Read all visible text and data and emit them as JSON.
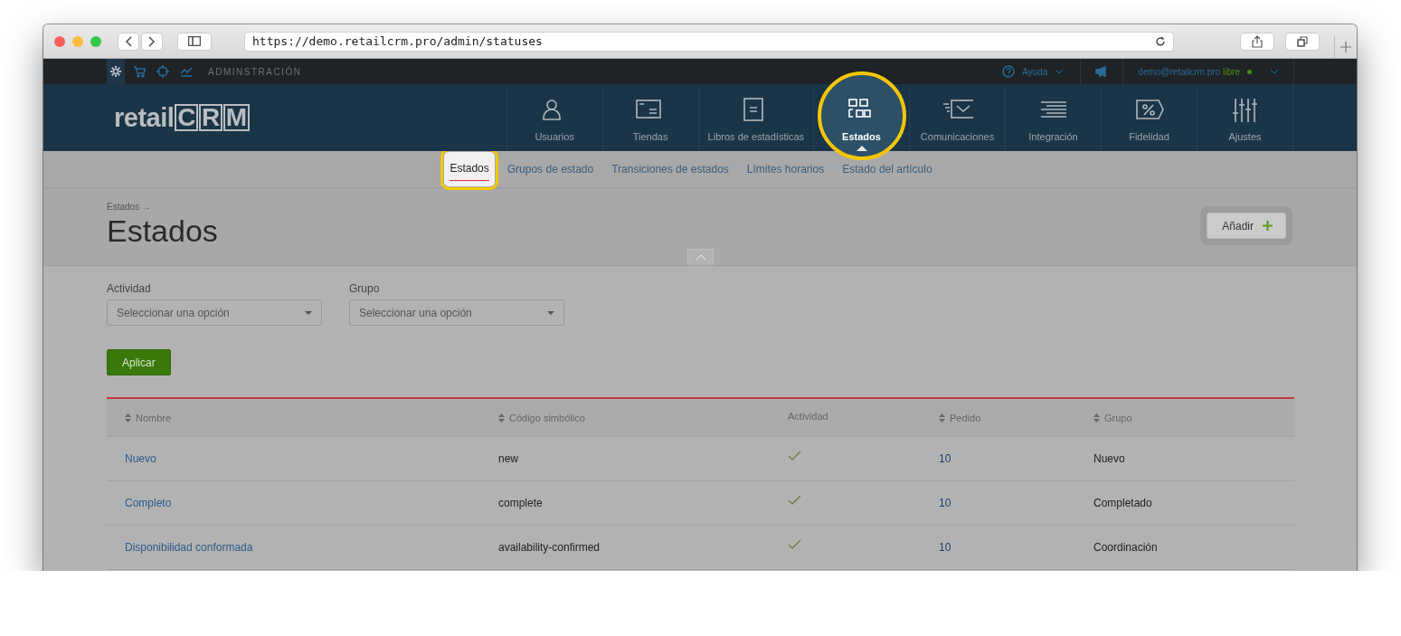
{
  "browser": {
    "url": "https://demo.retailcrm.pro/admin/statuses"
  },
  "top_bar": {
    "icons": [
      {
        "kind": "gear",
        "selected": true
      },
      {
        "kind": "cart",
        "selected": false
      },
      {
        "kind": "target",
        "selected": false
      },
      {
        "kind": "chart",
        "selected": false
      }
    ],
    "section_label": "ADMINSTRACIÓN",
    "help": "Ayuda",
    "user": "demo@retailcrm.pro",
    "plan": "libre"
  },
  "logo": {
    "prefix": "retail",
    "letters": [
      "C",
      "R",
      "M"
    ]
  },
  "main_nav": [
    {
      "label": "Usuarios",
      "kind": "user",
      "selected": false,
      "highlighted": false
    },
    {
      "label": "Tiendas",
      "kind": "store",
      "selected": false,
      "highlighted": false
    },
    {
      "label": "Libros de estadísticas",
      "kind": "book",
      "selected": false,
      "highlighted": false
    },
    {
      "label": "Estados",
      "kind": "statuses",
      "selected": true,
      "highlighted": true
    },
    {
      "label": "Comunicaciones",
      "kind": "mail",
      "selected": false,
      "highlighted": false
    },
    {
      "label": "Integración",
      "kind": "lines",
      "selected": false,
      "highlighted": false
    },
    {
      "label": "Fidelidad",
      "kind": "tag",
      "selected": false,
      "highlighted": false
    },
    {
      "label": "Ajustes",
      "kind": "sliders",
      "selected": false,
      "highlighted": false
    }
  ],
  "sub_nav": [
    {
      "label": "Estados",
      "selected": true,
      "highlighted": true
    },
    {
      "label": "Grupos de estado",
      "selected": false,
      "highlighted": false
    },
    {
      "label": "Transiciones de estados",
      "selected": false,
      "highlighted": false
    },
    {
      "label": "Límites horarios",
      "selected": false,
      "highlighted": false
    },
    {
      "label": "Estado del artículo",
      "selected": false,
      "highlighted": false
    }
  ],
  "breadcrumb": "Estados →",
  "page_title": "Estados",
  "add_button": "Añadir",
  "filters": [
    {
      "label": "Actividad",
      "placeholder": "Seleccionar una opción"
    },
    {
      "label": "Grupo",
      "placeholder": "Seleccionar una opción"
    }
  ],
  "apply_button": "Aplicar",
  "table": {
    "columns": [
      {
        "label": "Nombre",
        "sortable": true
      },
      {
        "label": "Código simbólico",
        "sortable": true
      },
      {
        "label": "Actividad",
        "sortable": false
      },
      {
        "label": "Pedido",
        "sortable": true
      },
      {
        "label": "Grupo",
        "sortable": true
      }
    ],
    "rows": [
      {
        "name": "Nuevo",
        "code": "new",
        "active": true,
        "order": "10",
        "group": "Nuevo"
      },
      {
        "name": "Completo",
        "code": "complete",
        "active": true,
        "order": "10",
        "group": "Completado"
      },
      {
        "name": "Disponibilidad conformada",
        "code": "availability-confirmed",
        "active": true,
        "order": "10",
        "group": "Coordinación"
      }
    ]
  }
}
